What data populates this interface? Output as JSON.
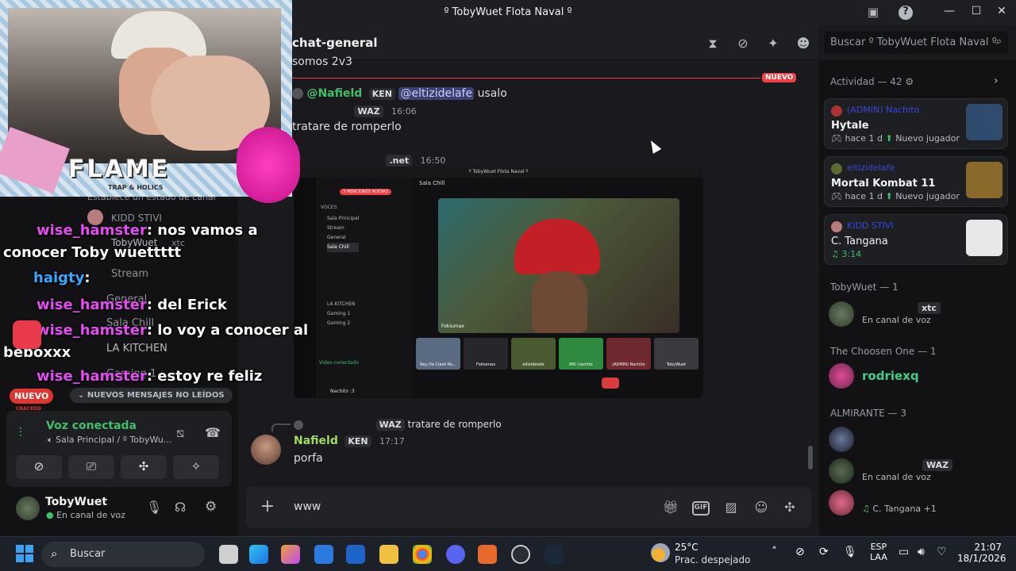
{
  "window": {
    "title": "º TobyWuet Flota Naval º"
  },
  "channel": {
    "name": "chat-general",
    "search_placeholder": "Buscar º TobyWuet Flota Naval º"
  },
  "messages": {
    "partial_top": "somos 2v3",
    "new_divider": "NUEVO",
    "m1": {
      "user": "@Nafield",
      "tag": "KEN",
      "mention": "@eltizidelafe",
      "text": "usalo"
    },
    "m2": {
      "tag": "WAZ",
      "time": "16:06",
      "text": "tratare de romperlo"
    },
    "m3": {
      "tag": ".net",
      "time": "16:50"
    },
    "embed": {
      "title": "º TobyWuet Flota Naval º",
      "channel": "Sala Chill",
      "new_mentions": "3 MENCIONES NUEVAS",
      "voices_header": "VOCES",
      "items": [
        "Sala Principal",
        "Stream",
        "General",
        "Sala Chill",
        "LA KITCHEN",
        "Gaming 1",
        "Gaming 2"
      ],
      "voice_connected": "Video conectado",
      "footer_user": "Nachito :3",
      "main_label": "Fokiumax",
      "tiles": [
        "Rey De Clash Ro...",
        "Fokiumax",
        "eltizidelafe",
        "MIC nachito",
        "(ADMIN) Nachito",
        "TobyWuet"
      ]
    },
    "reply": {
      "tag": "WAZ",
      "text": "tratare de romperlo"
    },
    "m4": {
      "user": "Nafield",
      "tag": "KEN",
      "time": "17:17",
      "text": "porfa"
    }
  },
  "composer": {
    "value": "www"
  },
  "left": {
    "overlay_chat": [
      {
        "user": "wise_hamster",
        "text": ": nos vamos a"
      },
      {
        "user": "",
        "text": "conocer Toby wuettttt"
      },
      {
        "user": "haigty",
        "text": ":"
      },
      {
        "user": "wise_hamster",
        "text": ": del Erick"
      },
      {
        "user": "wise_hamster",
        "text": ": lo voy a conocer al"
      },
      {
        "user": "",
        "text": "beboxxx"
      },
      {
        "user": "wise_hamster",
        "text": ": estoy re feliz"
      }
    ],
    "behind": [
      "Establece un estado de canal",
      "KIDD STIVI",
      "TobyWuet",
      "xtc",
      "Stream",
      "General",
      "Sala Chill",
      "LA KITCHEN",
      "Gaming 1"
    ],
    "nuevo_badge": "NUEVO",
    "unread_bar": "NUEVOS MENSAJES NO LEÍDOS",
    "logo_text": "FLAME",
    "logo_sub": "TRAP & HOLICS",
    "cracked": "CRACKED",
    "voice": {
      "status": "Voz conectada",
      "location": "Sala Principal / º TobyWu..."
    },
    "user": {
      "name": "TobyWuet",
      "status": "En canal de voz"
    }
  },
  "right": {
    "activity_header": "Actividad — 42",
    "cards": [
      {
        "user": "(ADMIN) Nachito",
        "game": "Hytale",
        "time": "hace 1 d",
        "extra": "Nuevo jugador",
        "color": "#2f4b6e"
      },
      {
        "user": "eltizidelafe",
        "game": "Mortal Kombat 11",
        "time": "hace 1 d",
        "extra": "Nuevo jugador",
        "color": "#8a6a2a"
      },
      {
        "user": "KIDD STIVI",
        "game": "C. Tangana",
        "time": "3:14",
        "extra": "",
        "color": "#e8e8e8"
      }
    ],
    "sections": [
      {
        "title": "TobyWuet — 1"
      },
      {
        "title": "The Choosen One — 1"
      },
      {
        "title": "ALMIRANTE — 3"
      }
    ],
    "members": [
      {
        "name": "",
        "badge": "xtc",
        "status": "En canal de voz"
      },
      {
        "name": "rodriexq",
        "status": ""
      },
      {
        "name": "",
        "status": ""
      },
      {
        "name": "",
        "badge": "WAZ",
        "status": "En canal de voz"
      },
      {
        "name": "",
        "status": "C. Tangana +1"
      }
    ]
  },
  "taskbar": {
    "search": "Buscar",
    "weather_temp": "25°C",
    "weather_desc": "Prac. despejado",
    "lang1": "ESP",
    "lang2": "LAA",
    "time": "21:07",
    "date": "18/1/2026"
  }
}
